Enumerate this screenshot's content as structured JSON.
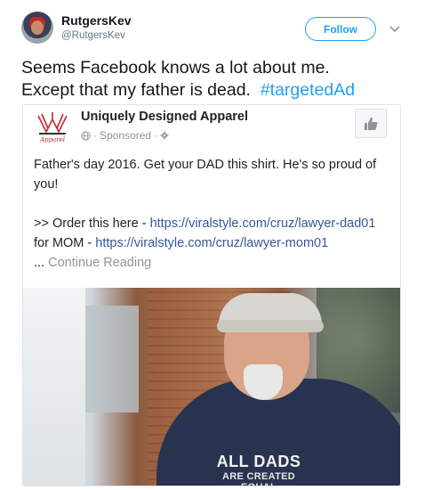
{
  "tweet": {
    "display_name": "RutgersKev",
    "handle": "@RutgersKev",
    "follow_label": "Follow",
    "text_line1": "Seems Facebook knows a lot about me.",
    "text_line2_main": "Except that my father is dead.",
    "hashtag": "#targetedAd"
  },
  "ad": {
    "page_name": "Uniquely Designed Apparel",
    "sponsored_label": "Sponsored",
    "body_line1": "Father's day 2016. Get your DAD this shirt. He's so proud of you!",
    "order_prefix": ">> Order this here - ",
    "order_link": "https://viralstyle.com/cruz/lawyer-dad01",
    "mom_prefix": "for MOM - ",
    "mom_link": "https://viralstyle.com/cruz/lawyer-mom01",
    "continue_prefix": "... ",
    "continue_label": "Continue Reading",
    "shirt_text_line1": "ALL DADS",
    "shirt_text_line2": "ARE CREATED EQUAL"
  },
  "icons": {
    "menu": "chevron-down-icon",
    "globe": "globe-icon",
    "settings": "gear-icon",
    "like": "thumbs-up-icon"
  },
  "colors": {
    "twitter_blue": "#1da1f2",
    "fb_link": "#365899",
    "text_dark": "#14171a",
    "muted": "#657786"
  }
}
